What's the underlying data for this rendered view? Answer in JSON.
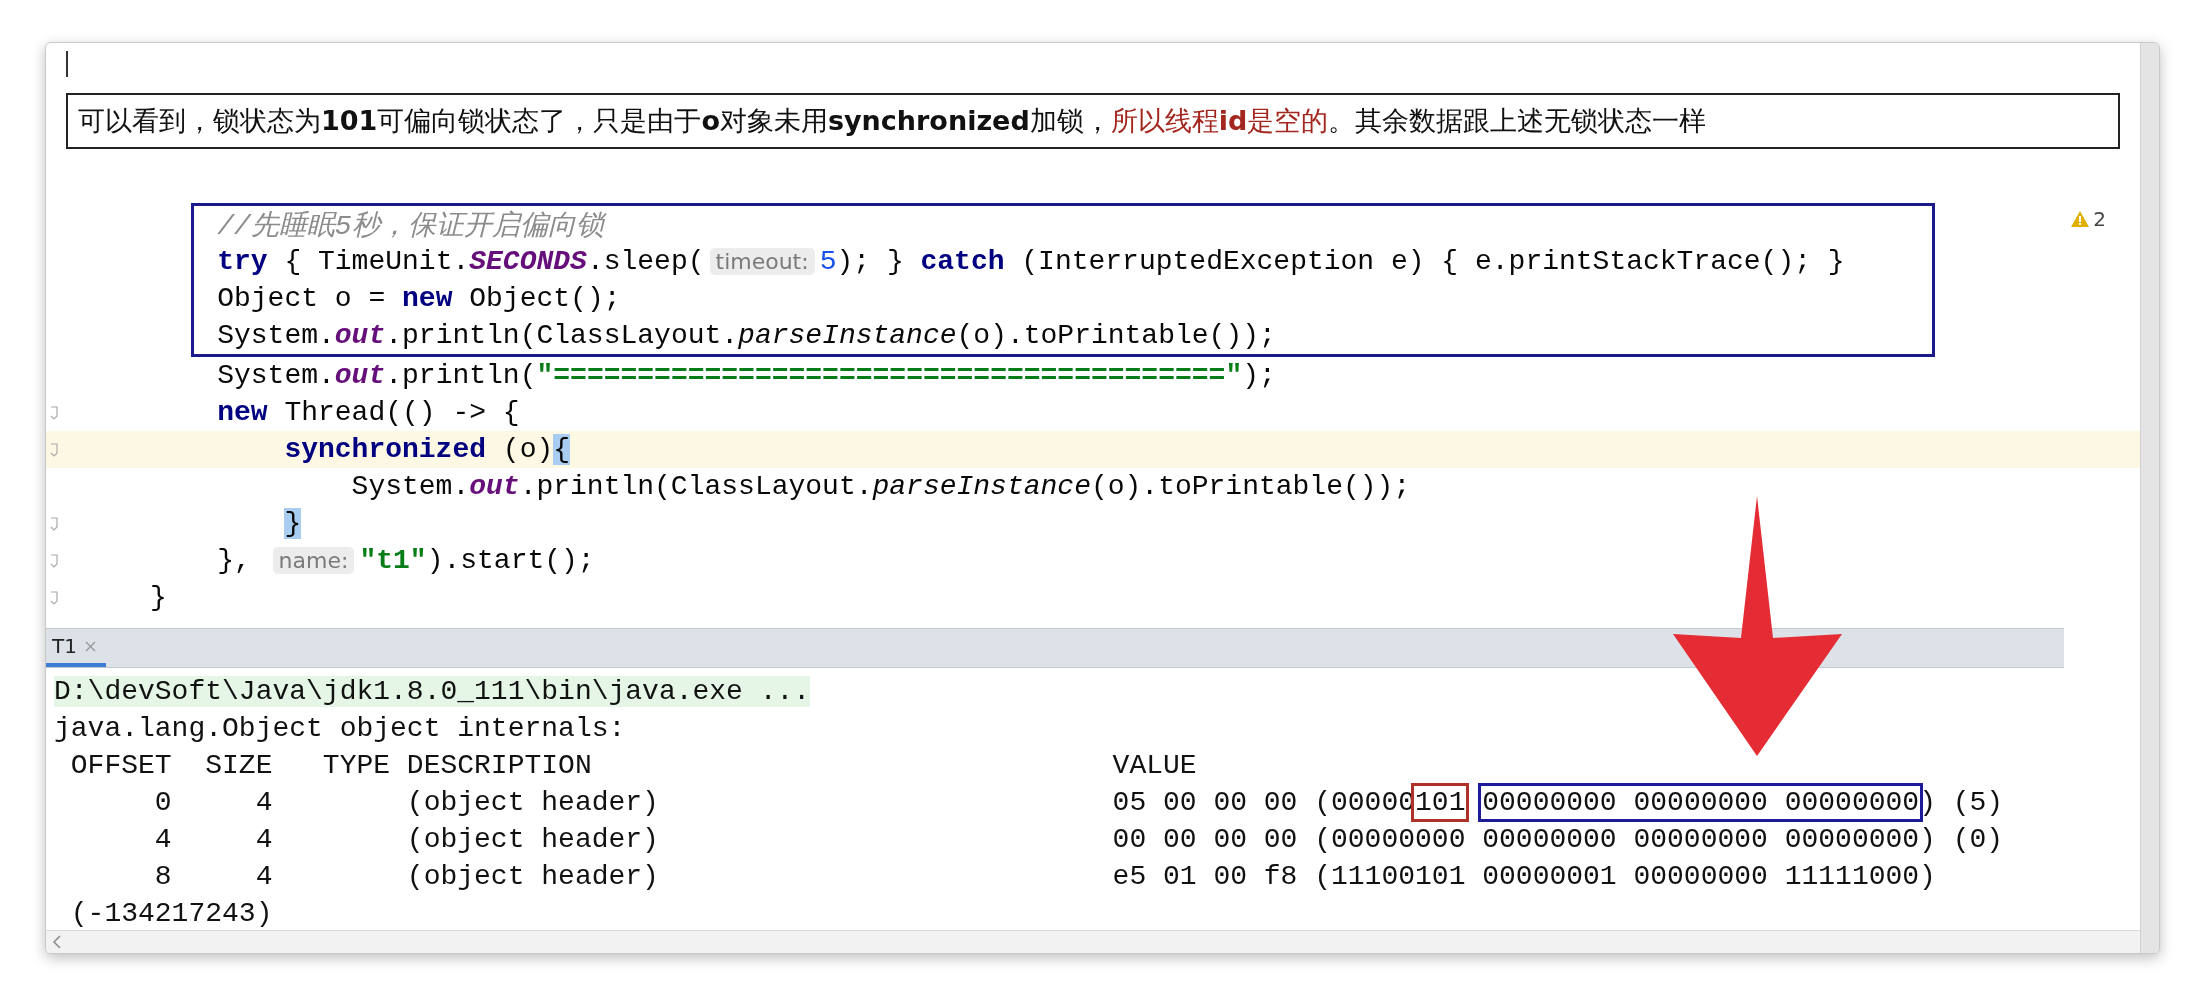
{
  "note": {
    "segments": [
      {
        "kind": "plain",
        "text": "可以看到，锁状态为**101**可偏向锁状态了，只是由于**o**对象未用**synchronized**加锁，"
      },
      {
        "kind": "highlight",
        "text": "所以线程**id**是空的"
      },
      {
        "kind": "plain",
        "text": "。其余数据跟上述无锁状态一样"
      }
    ]
  },
  "editor": {
    "warnings": "2",
    "framed_lines": [
      {
        "tokens": [
          {
            "kind": "comment",
            "text": "//先睡眠5秒，保证开启偏向锁"
          }
        ]
      },
      {
        "tokens": [
          {
            "kind": "keyword",
            "text": "try"
          },
          {
            "kind": "plain",
            "text": " { TimeUnit."
          },
          {
            "kind": "field",
            "text": "SECONDS"
          },
          {
            "kind": "plain",
            "text": ".sleep("
          },
          {
            "kind": "hint",
            "text": "timeout:"
          },
          {
            "kind": "number",
            "text": "5"
          },
          {
            "kind": "plain",
            "text": "); } "
          },
          {
            "kind": "keyword",
            "text": "catch"
          },
          {
            "kind": "plain",
            "text": " (InterruptedException e) { e.printStackTrace(); }"
          }
        ]
      },
      {
        "tokens": [
          {
            "kind": "plain",
            "text": "Object o = "
          },
          {
            "kind": "keyword",
            "text": "new"
          },
          {
            "kind": "plain",
            "text": " Object();"
          }
        ]
      },
      {
        "tokens": [
          {
            "kind": "plain",
            "text": "System."
          },
          {
            "kind": "field",
            "text": "out"
          },
          {
            "kind": "plain",
            "text": ".println(ClassLayout."
          },
          {
            "kind": "italic",
            "text": "parseInstance"
          },
          {
            "kind": "plain",
            "text": "(o).toPrintable());"
          }
        ]
      }
    ],
    "lines": [
      {
        "highlighted": false,
        "fold": false,
        "tokens": [
          {
            "kind": "plain",
            "text": "System."
          },
          {
            "kind": "field",
            "text": "out"
          },
          {
            "kind": "plain",
            "text": ".println("
          },
          {
            "kind": "string",
            "text": "\"========================================\""
          },
          {
            "kind": "plain",
            "text": ");"
          }
        ]
      },
      {
        "highlighted": false,
        "fold": true,
        "tokens": [
          {
            "kind": "keyword",
            "text": "new"
          },
          {
            "kind": "plain",
            "text": " Thread(() -> {"
          }
        ],
        "children": [
          {
            "highlighted": true,
            "fold": true,
            "tokens": [
              {
                "kind": "keyword",
                "text": "synchronized"
              },
              {
                "kind": "plain",
                "text": " (o)"
              },
              {
                "kind": "brace",
                "text": "{"
              }
            ],
            "children": [
              {
                "highlighted": false,
                "fold": false,
                "tokens": [
                  {
                    "kind": "plain",
                    "text": "System."
                  },
                  {
                    "kind": "field",
                    "text": "out"
                  },
                  {
                    "kind": "plain",
                    "text": ".println(ClassLayout."
                  },
                  {
                    "kind": "italic",
                    "text": "parseInstance"
                  },
                  {
                    "kind": "plain",
                    "text": "(o).toPrintable());"
                  }
                ]
              }
            ]
          },
          {
            "highlighted": false,
            "fold": true,
            "tokens": [
              {
                "kind": "brace",
                "text": "}"
              }
            ]
          }
        ]
      },
      {
        "highlighted": false,
        "fold": true,
        "tokens": [
          {
            "kind": "plain",
            "text": "}, "
          },
          {
            "kind": "hint",
            "text": "name:"
          },
          {
            "kind": "string",
            "text": "\"t1\""
          },
          {
            "kind": "plain",
            "text": ").start();"
          }
        ]
      }
    ],
    "closing_line": {
      "highlighted": false,
      "fold": true,
      "tokens": [
        {
          "kind": "plain",
          "text": "}"
        }
      ]
    }
  },
  "console": {
    "tabs": [
      {
        "label": "T1",
        "selected": true
      }
    ],
    "lines": [
      {
        "kind": "command",
        "segments": [
          {
            "text": "D:\\devSoft\\Java\\jdk1.8.0_111\\bin\\java.exe ..."
          }
        ]
      },
      {
        "kind": "output",
        "segments": [
          {
            "text": "java.lang.Object object internals:"
          }
        ]
      },
      {
        "kind": "output",
        "segments": [
          {
            "text": " OFFSET  SIZE   TYPE DESCRIPTION                               VALUE"
          }
        ]
      },
      {
        "kind": "output",
        "segments": [
          {
            "text": "      0     4        (object header)                           05 00 00 00 (00000"
          },
          {
            "text": "101",
            "color": "#b0302a"
          },
          {
            "text": "00000000 00000000 00000000",
            "color": "#1c1c9a"
          },
          {
            "text": ") (5)"
          }
        ]
      },
      {
        "kind": "output",
        "segments": [
          {
            "text": "      4     4        (object header)                           00 00 00 00 (00000000 00000000 00000000 00000000) (0)"
          }
        ]
      },
      {
        "kind": "output",
        "segments": [
          {
            "text": "      8     4        (object header)                           e5 01 00 f8 (11100101 00000001 00000000 11111000)"
          }
        ]
      },
      {
        "kind": "output",
        "segments": [
          {
            "text": " (-134217243)"
          }
        ]
      }
    ]
  }
}
